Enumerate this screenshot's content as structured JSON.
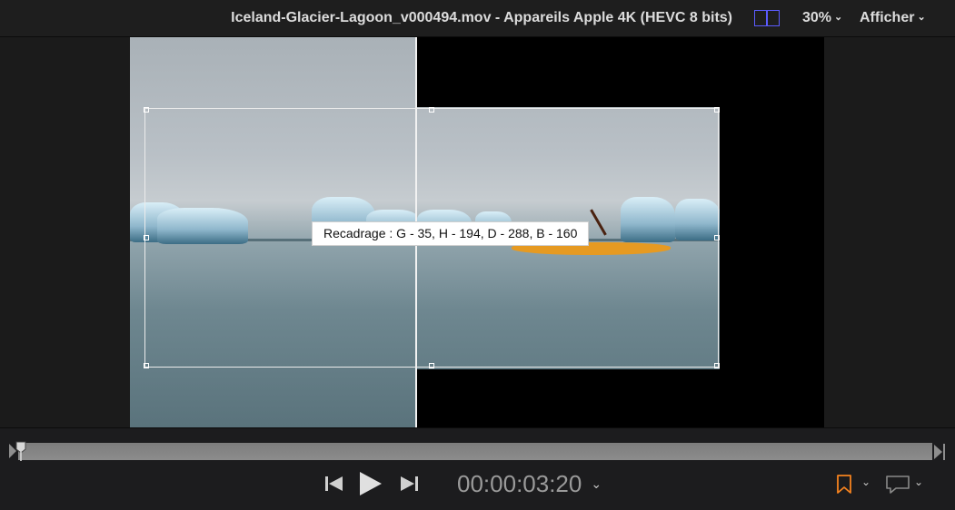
{
  "header": {
    "title": "Iceland-Glacier-Lagoon_v000494.mov - Appareils Apple 4K (HEVC 8 bits)",
    "zoom": "30%",
    "view_menu": "Afficher",
    "chevron": "⌄",
    "compare_icon": "split-compare-icon"
  },
  "viewer": {
    "crop_readout": "Recadrage : G - 35, H - 194, D - 288, B - 160"
  },
  "transport": {
    "timecode": "00:00:03:20",
    "chevron": "⌄",
    "icons": [
      "skip-back-icon",
      "play-icon",
      "skip-forward-icon"
    ]
  },
  "right_controls": {
    "marker_icon": "marker-flag-icon",
    "comment_icon": "comment-icon",
    "chevron": "⌄"
  },
  "colors": {
    "accent_blue": "#5b5bff",
    "marker_orange": "#f5821f",
    "crop_label_bg": "#ffffff"
  }
}
